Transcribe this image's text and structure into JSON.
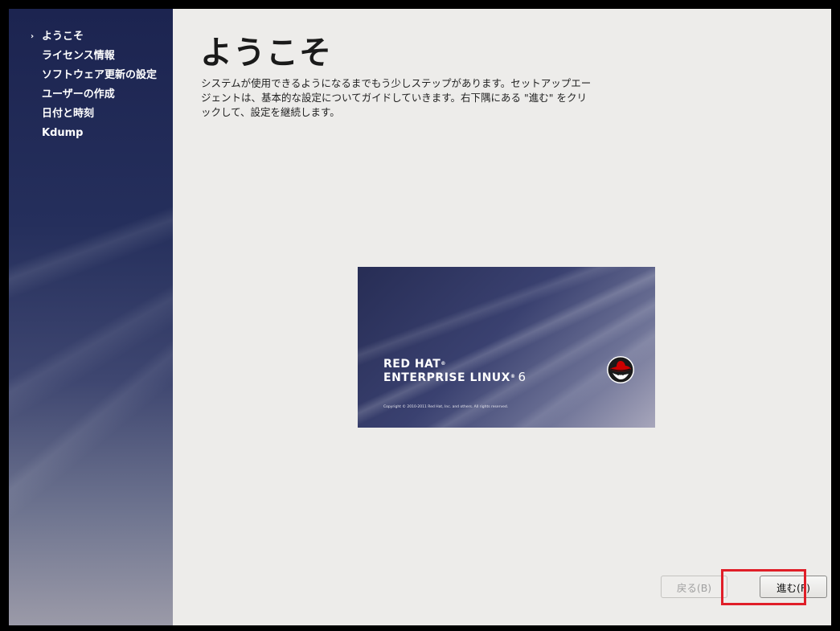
{
  "sidebar": {
    "items": [
      {
        "label": "ようこそ",
        "active": true
      },
      {
        "label": "ライセンス情報",
        "active": false
      },
      {
        "label": "ソフトウェア更新の設定",
        "active": false
      },
      {
        "label": "ユーザーの作成",
        "active": false
      },
      {
        "label": "日付と時刻",
        "active": false
      },
      {
        "label": "Kdump",
        "active": false
      }
    ],
    "active_marker": "›"
  },
  "main": {
    "title": "ようこそ",
    "intro": "システムが使用できるようになるまでもう少しステップがあります。セットアップエージェントは、基本的な設定についてガイドしていきます。右下隅にある \"進む\" をクリックして、設定を継続します。"
  },
  "splash": {
    "brand_line1": "RED HAT",
    "brand_line1_mark": "®",
    "brand_line2": "ENTERPRISE LINUX",
    "brand_line2_mark": "®",
    "version": "6",
    "copyright": "Copyright © 2010-2011 Red Hat, Inc. and others. All rights reserved.",
    "logo_icon": "red-hat-shadowman-logo"
  },
  "buttons": {
    "back": {
      "label": "戻る(B)",
      "enabled": false
    },
    "next": {
      "label": "進む(F)",
      "enabled": true
    }
  },
  "colors": {
    "highlight": "#e01e28",
    "sidebar_top": "#1c2450",
    "content_bg": "#edecea"
  }
}
